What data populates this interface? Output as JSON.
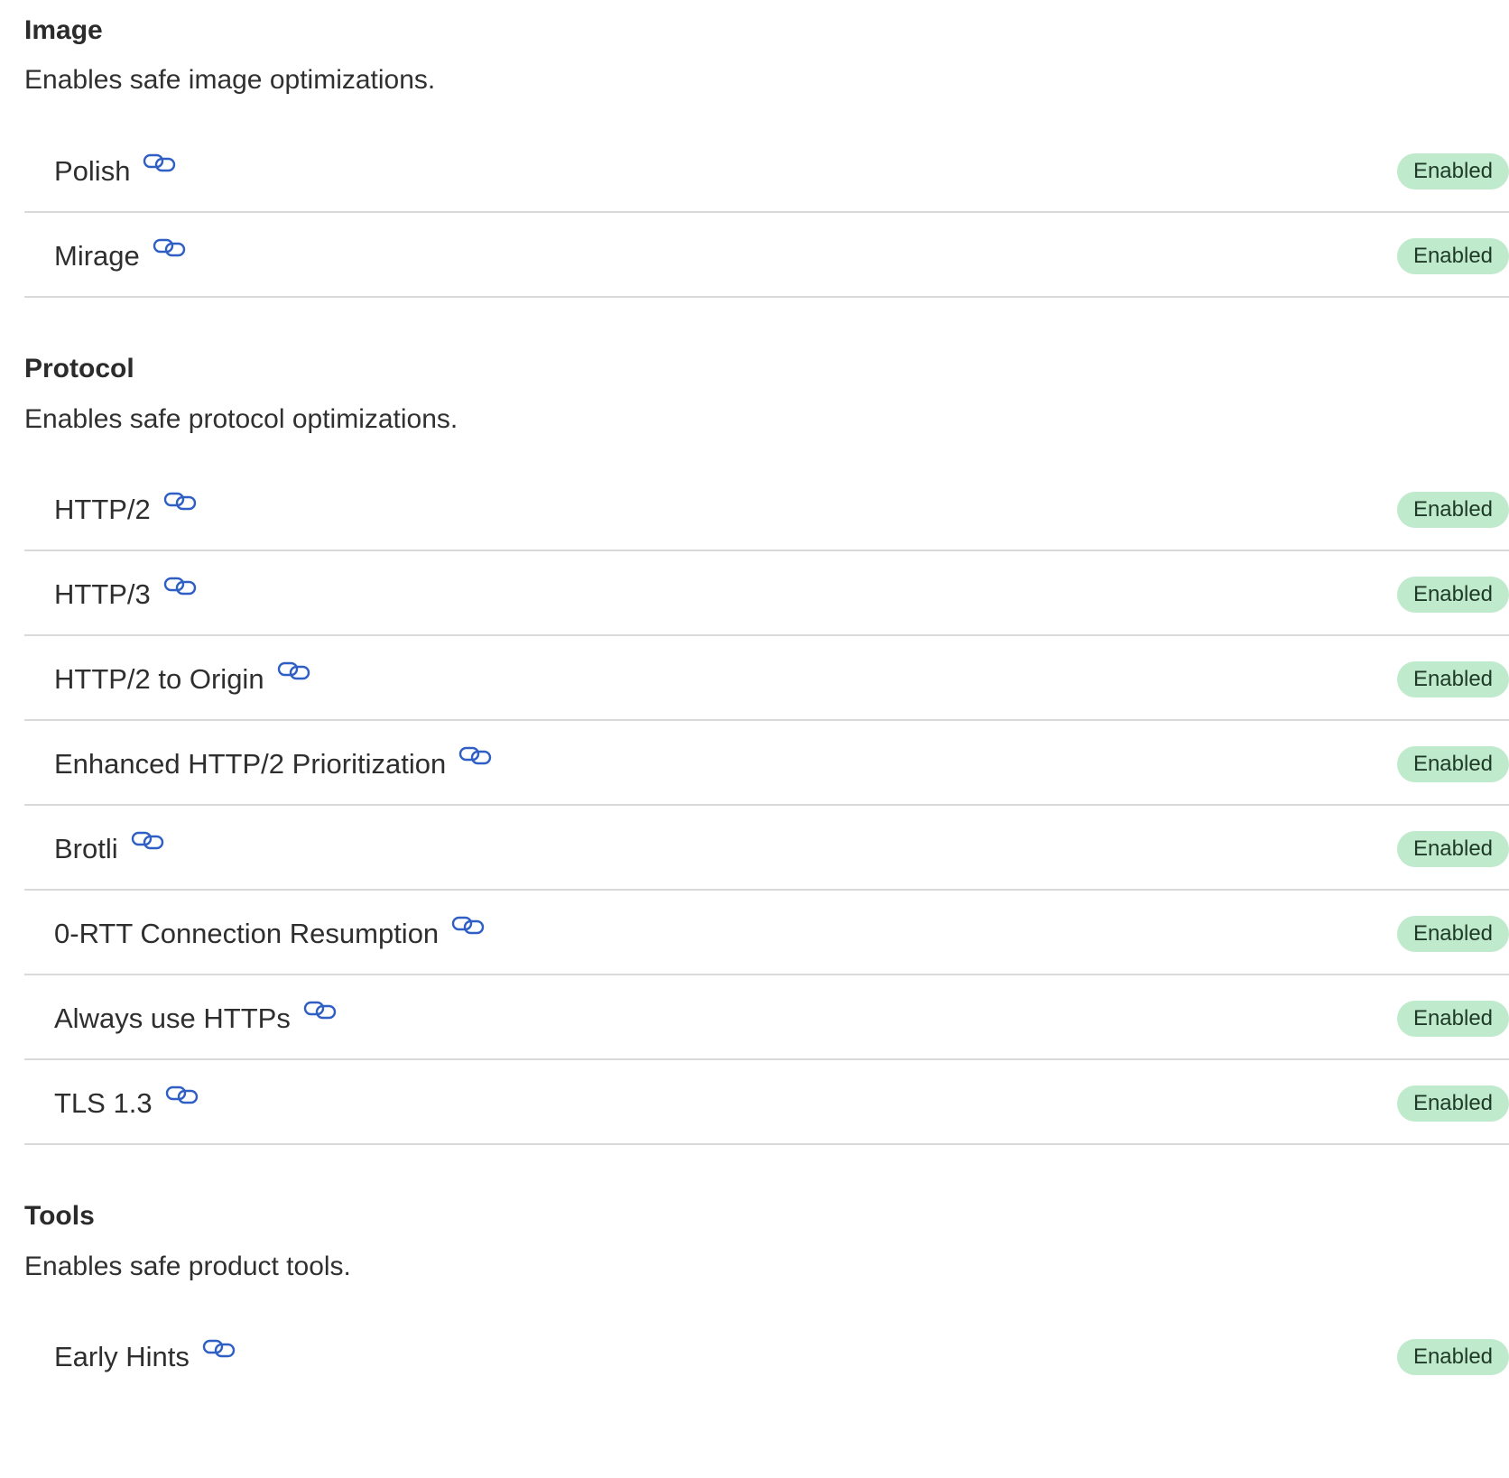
{
  "sections": [
    {
      "title": "Image",
      "description": "Enables safe image optimizations.",
      "items": [
        {
          "label": "Polish",
          "status": "Enabled",
          "icon": "link-icon"
        },
        {
          "label": "Mirage",
          "status": "Enabled",
          "icon": "link-icon"
        }
      ]
    },
    {
      "title": "Protocol",
      "description": "Enables safe protocol optimizations.",
      "items": [
        {
          "label": "HTTP/2",
          "status": "Enabled",
          "icon": "link-icon"
        },
        {
          "label": "HTTP/3",
          "status": "Enabled",
          "icon": "link-icon"
        },
        {
          "label": "HTTP/2 to Origin",
          "status": "Enabled",
          "icon": "link-icon"
        },
        {
          "label": "Enhanced HTTP/2 Prioritization",
          "status": "Enabled",
          "icon": "link-icon"
        },
        {
          "label": "Brotli",
          "status": "Enabled",
          "icon": "link-icon"
        },
        {
          "label": "0-RTT Connection Resumption",
          "status": "Enabled",
          "icon": "link-icon"
        },
        {
          "label": "Always use HTTPs",
          "status": "Enabled",
          "icon": "link-icon"
        },
        {
          "label": "TLS 1.3",
          "status": "Enabled",
          "icon": "link-icon"
        }
      ]
    },
    {
      "title": "Tools",
      "description": "Enables safe product tools.",
      "items": [
        {
          "label": "Early Hints",
          "status": "Enabled",
          "icon": "link-icon"
        }
      ]
    }
  ],
  "colors": {
    "badge_bg": "#bfeacb",
    "badge_text": "#1f3a28",
    "link_icon": "#2f5fc4",
    "divider": "#d9d9d9"
  }
}
